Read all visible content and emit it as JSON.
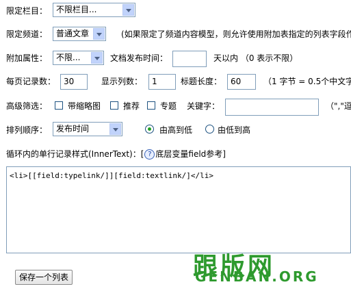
{
  "form": {
    "column_label": "限定栏目：",
    "column_select": "不限栏目...",
    "channel_label": "限定频道：",
    "channel_select": "普通文章",
    "channel_note": "(如果限定了频道内容模型，则允许使用附加表指定的列表字段作",
    "attr_label": "附加属性：",
    "attr_select": "不限...",
    "pubtime_label": "文档发布时间：",
    "pubtime_value": "",
    "pubtime_suffix": "天以内 （0 表示不限）",
    "perpage_label": "每页记录数：",
    "perpage_value": "30",
    "cols_label": "显示列数：",
    "cols_value": "1",
    "titlelen_label": "标题长度：",
    "titlelen_value": "60",
    "titlelen_note": "（1 字节 = 0.5个中文字",
    "filter_label": "高级筛选：",
    "filter_thumb": "带缩略图",
    "filter_recommend": "推荐",
    "filter_special": "专题",
    "keyword_label": "关键字：",
    "keyword_value": "",
    "keyword_note": "（\",\"逗",
    "order_label": "排列顺序：",
    "order_select": "发布时间",
    "order_desc": "由高到低",
    "order_asc": "由低到高",
    "innertext_label": "循环内的单行记录样式(InnerText)：[",
    "innertext_link": "底层变量field参考",
    "innertext_close": "]",
    "innertext_value": "<li>[[field:typelink/]][field:textlink/]</li>",
    "save_button": "保存一个列表"
  },
  "watermark": {
    "cn": "跟版网",
    "en": "GENBAN.ORG"
  },
  "icons": {
    "help": "help-question-icon"
  },
  "colors": {
    "watermark": "#2e9a2e",
    "border": "#7f9db9",
    "radio_dot": "#21a121"
  },
  "state": {
    "order_selected": "desc",
    "filter_thumb_checked": false,
    "filter_recommend_checked": false,
    "filter_special_checked": false
  }
}
